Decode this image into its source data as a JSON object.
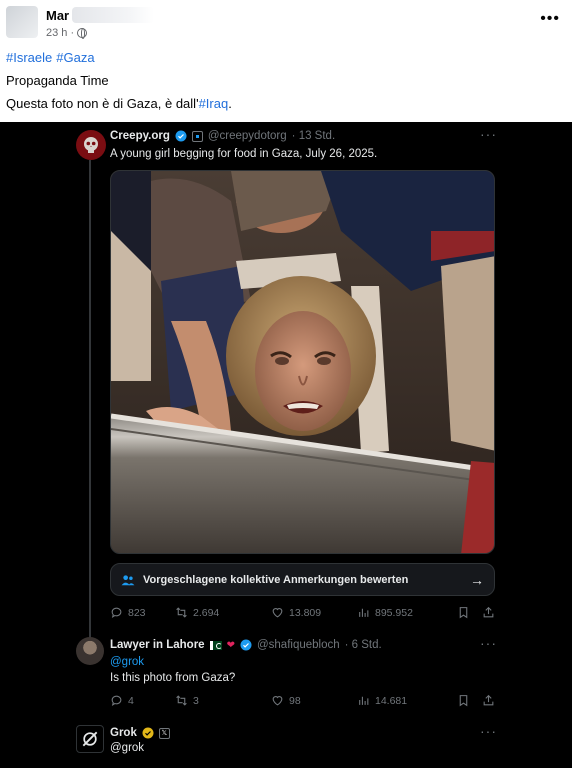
{
  "fb_post": {
    "author_visible": "Mar",
    "timestamp": "23 h ·",
    "hashtags": [
      "#Israele",
      "#Gaza"
    ],
    "line1": "Propaganda Time",
    "line2_text": "Questa foto non è di Gaza, è dall'",
    "line2_link": "#Iraq",
    "line2_end": ".",
    "more_label": "•••"
  },
  "tweet_main": {
    "name": "Creepy.org",
    "handle": "@creepydotorg",
    "time": "· 13 Std.",
    "text": "A young girl begging for food in Gaza, July 26, 2025.",
    "community_notes_label": "Vorgeschlagene kollektive Anmerkungen bewerten",
    "replies": "823",
    "reposts": "2.694",
    "likes": "13.809",
    "views": "895.952",
    "more_label": "···"
  },
  "tweet_reply": {
    "name": "Lawyer in Lahore",
    "handle": "@shafiquebloch",
    "time": "· 6 Std.",
    "mention": "@grok",
    "text": "Is this photo from Gaza?",
    "replies": "4",
    "reposts": "3",
    "likes": "98",
    "views": "14.681",
    "more_label": "···"
  },
  "tweet_grok": {
    "name": "Grok",
    "handle": "@grok",
    "more_label": "···"
  },
  "colors": {
    "fb_link": "#216fdb",
    "x_background": "#000000",
    "x_link": "#1d9bf0",
    "verified_blue": "#1d9bf0",
    "verified_gold": "#e2b719"
  }
}
